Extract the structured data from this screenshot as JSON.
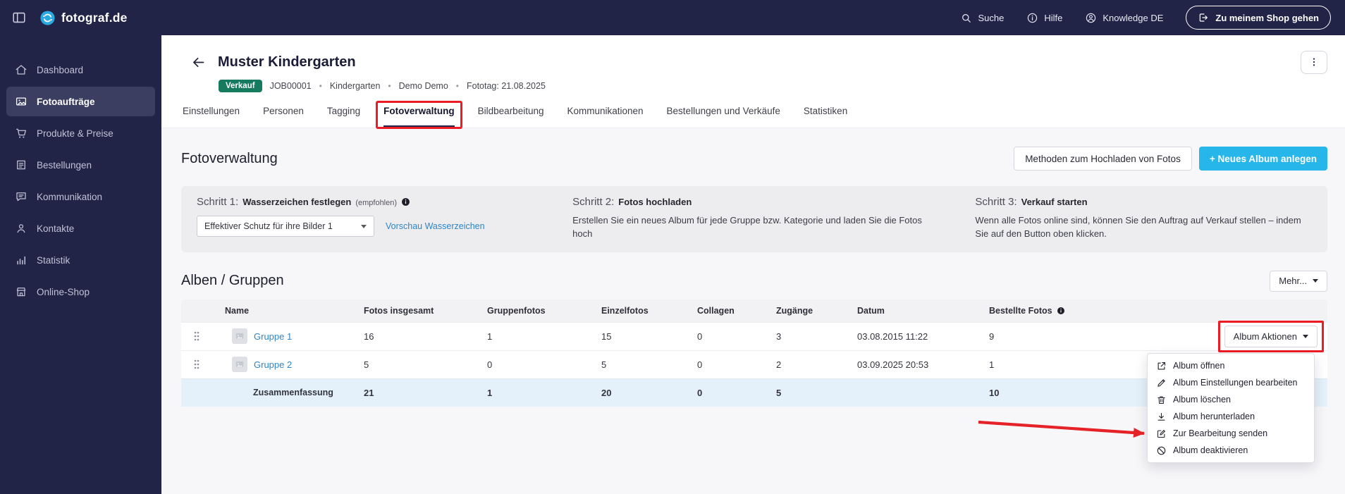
{
  "topbar": {
    "brand": "fotograf.de",
    "search": "Suche",
    "help": "Hilfe",
    "knowledge": "Knowledge DE",
    "shop_button": "Zu meinem Shop gehen"
  },
  "sidebar": {
    "items": [
      {
        "label": "Dashboard"
      },
      {
        "label": "Fotoaufträge"
      },
      {
        "label": "Produkte & Preise"
      },
      {
        "label": "Bestellungen"
      },
      {
        "label": "Kommunikation"
      },
      {
        "label": "Kontakte"
      },
      {
        "label": "Statistik"
      },
      {
        "label": "Online-Shop"
      }
    ]
  },
  "header": {
    "title": "Muster Kindergarten",
    "badge": "Verkauf",
    "job_id": "JOB00001",
    "category": "Kindergarten",
    "owner": "Demo Demo",
    "fototag": "Fototag: 21.08.2025"
  },
  "tabs": {
    "items": [
      {
        "label": "Einstellungen"
      },
      {
        "label": "Personen"
      },
      {
        "label": "Tagging"
      },
      {
        "label": "Fotoverwaltung"
      },
      {
        "label": "Bildbearbeitung"
      },
      {
        "label": "Kommunikationen"
      },
      {
        "label": "Bestellungen und Verkäufe"
      },
      {
        "label": "Statistiken"
      }
    ],
    "active": "Fotoverwaltung"
  },
  "section": {
    "title": "Fotoverwaltung",
    "upload_methods_button": "Methoden zum Hochladen von Fotos",
    "new_album_button": "+ Neues Album anlegen"
  },
  "steps": [
    {
      "prefix": "Schritt 1:",
      "title": "Wasserzeichen festlegen",
      "hint": "(empfohlen)",
      "select_value": "Effektiver Schutz für ihre Bilder 1",
      "link": "Vorschau Wasserzeichen"
    },
    {
      "prefix": "Schritt 2:",
      "title": "Fotos hochladen",
      "body": "Erstellen Sie ein neues Album für jede Gruppe bzw. Kategorie und laden Sie die Fotos hoch"
    },
    {
      "prefix": "Schritt 3:",
      "title": "Verkauf starten",
      "body": "Wenn alle Fotos online sind, können Sie den Auftrag auf Verkauf stellen – indem Sie auf den Button oben klicken."
    }
  ],
  "albums": {
    "title": "Alben / Gruppen",
    "more_button": "Mehr...",
    "columns": {
      "name": "Name",
      "total": "Fotos insgesamt",
      "group_photos": "Gruppenfotos",
      "single_photos": "Einzelfotos",
      "collages": "Collagen",
      "accesses": "Zugänge",
      "date": "Datum",
      "ordered": "Bestellte Fotos"
    },
    "action_button": "Album Aktionen",
    "rows": [
      {
        "name": "Gruppe 1",
        "total": "16",
        "group_photos": "1",
        "single_photos": "15",
        "collages": "0",
        "accesses": "3",
        "date": "03.08.2015 11:22",
        "ordered": "9"
      },
      {
        "name": "Gruppe 2",
        "total": "5",
        "group_photos": "0",
        "single_photos": "5",
        "collages": "0",
        "accesses": "2",
        "date": "03.09.2025 20:53",
        "ordered": "1"
      }
    ],
    "summary": {
      "label": "Zusammenfassung",
      "total": "21",
      "group_photos": "1",
      "single_photos": "20",
      "collages": "0",
      "accesses": "5",
      "ordered": "10"
    }
  },
  "context_menu": {
    "items": [
      {
        "label": "Album öffnen"
      },
      {
        "label": "Album Einstellungen bearbeiten"
      },
      {
        "label": "Album löschen"
      },
      {
        "label": "Album herunterladen"
      },
      {
        "label": "Zur Bearbeitung senden"
      },
      {
        "label": "Album deaktivieren"
      }
    ]
  },
  "colors": {
    "navy": "#212347",
    "accent_cyan": "#27b6e9",
    "badge_green": "#157a5e",
    "link_blue": "#2e85c7",
    "annotation_red": "#ed1c24"
  }
}
